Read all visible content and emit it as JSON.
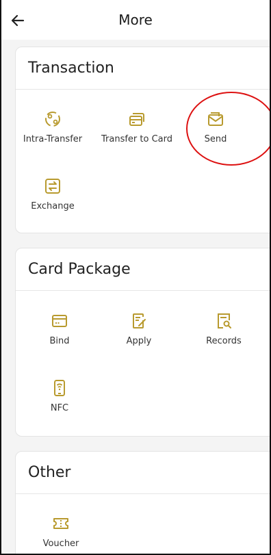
{
  "header": {
    "title": "More",
    "back_icon": "arrow-left-icon"
  },
  "accent": "#b89a2e",
  "highlight_color": "#dd1111",
  "sections": [
    {
      "title": "Transaction",
      "items": [
        {
          "label": "Intra-Transfer",
          "icon": "exchange-circle-icon"
        },
        {
          "label": "Transfer to Card",
          "icon": "card-transfer-icon"
        },
        {
          "label": "Send",
          "icon": "send-envelope-icon"
        },
        {
          "label": "Exchange",
          "icon": "exchange-arrows-icon"
        }
      ]
    },
    {
      "title": "Card Package",
      "items": [
        {
          "label": "Bind",
          "icon": "card-icon"
        },
        {
          "label": "Apply",
          "icon": "edit-document-icon"
        },
        {
          "label": "Records",
          "icon": "search-document-icon"
        },
        {
          "label": "NFC",
          "icon": "nfc-phone-icon"
        }
      ]
    },
    {
      "title": "Other",
      "items": [
        {
          "label": "Voucher",
          "icon": "ticket-icon"
        }
      ]
    }
  ]
}
